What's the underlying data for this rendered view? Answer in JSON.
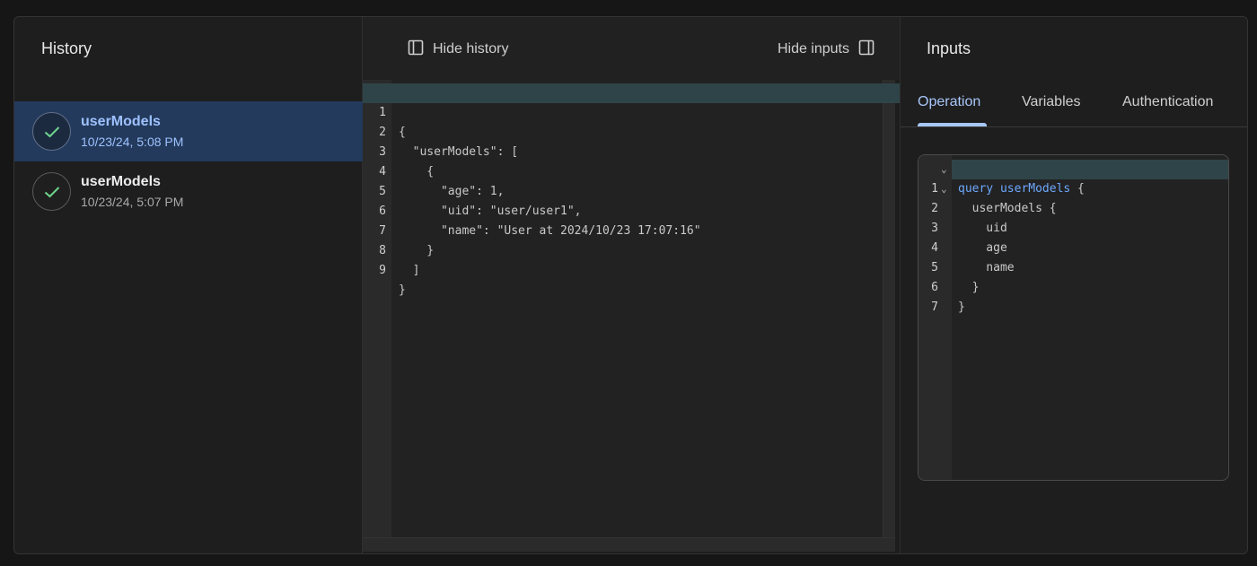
{
  "history": {
    "title": "History",
    "items": [
      {
        "name": "userModels",
        "time": "10/23/24, 5:08 PM",
        "selected": true,
        "status_icon": "check-icon"
      },
      {
        "name": "userModels",
        "time": "10/23/24, 5:07 PM",
        "selected": false,
        "status_icon": "check-icon"
      }
    ]
  },
  "toolbar": {
    "hide_history": "Hide history",
    "hide_inputs": "Hide inputs"
  },
  "response": {
    "lines": [
      {
        "num": "1",
        "text": "{"
      },
      {
        "num": "2",
        "text": "  \"userModels\": ["
      },
      {
        "num": "3",
        "text": "    {"
      },
      {
        "num": "4",
        "text": "      \"age\": 1,"
      },
      {
        "num": "5",
        "text": "      \"uid\": \"user/user1\","
      },
      {
        "num": "6",
        "text": "      \"name\": \"User at 2024/10/23 17:07:16\""
      },
      {
        "num": "7",
        "text": "    }"
      },
      {
        "num": "8",
        "text": "  ]"
      },
      {
        "num": "9",
        "text": "}"
      }
    ]
  },
  "inputs": {
    "title": "Inputs",
    "tabs": [
      "Operation",
      "Variables",
      "Authentication"
    ],
    "active_tab": "Operation",
    "operation": {
      "lines": [
        {
          "num": "1",
          "fold": "⌄",
          "kw": "query userModels",
          "text": " {"
        },
        {
          "num": "2",
          "fold": "⌄",
          "kw": "",
          "text": "  userModels {"
        },
        {
          "num": "3",
          "fold": "",
          "kw": "",
          "text": "    uid"
        },
        {
          "num": "4",
          "fold": "",
          "kw": "",
          "text": "    age"
        },
        {
          "num": "5",
          "fold": "",
          "kw": "",
          "text": "    name"
        },
        {
          "num": "6",
          "fold": "",
          "kw": "",
          "text": "  }"
        },
        {
          "num": "7",
          "fold": "",
          "kw": "",
          "text": "}"
        }
      ]
    }
  },
  "colors": {
    "accent": "#a8c7fa",
    "success": "#6dd58c",
    "selected_bg": "#233a5c"
  }
}
